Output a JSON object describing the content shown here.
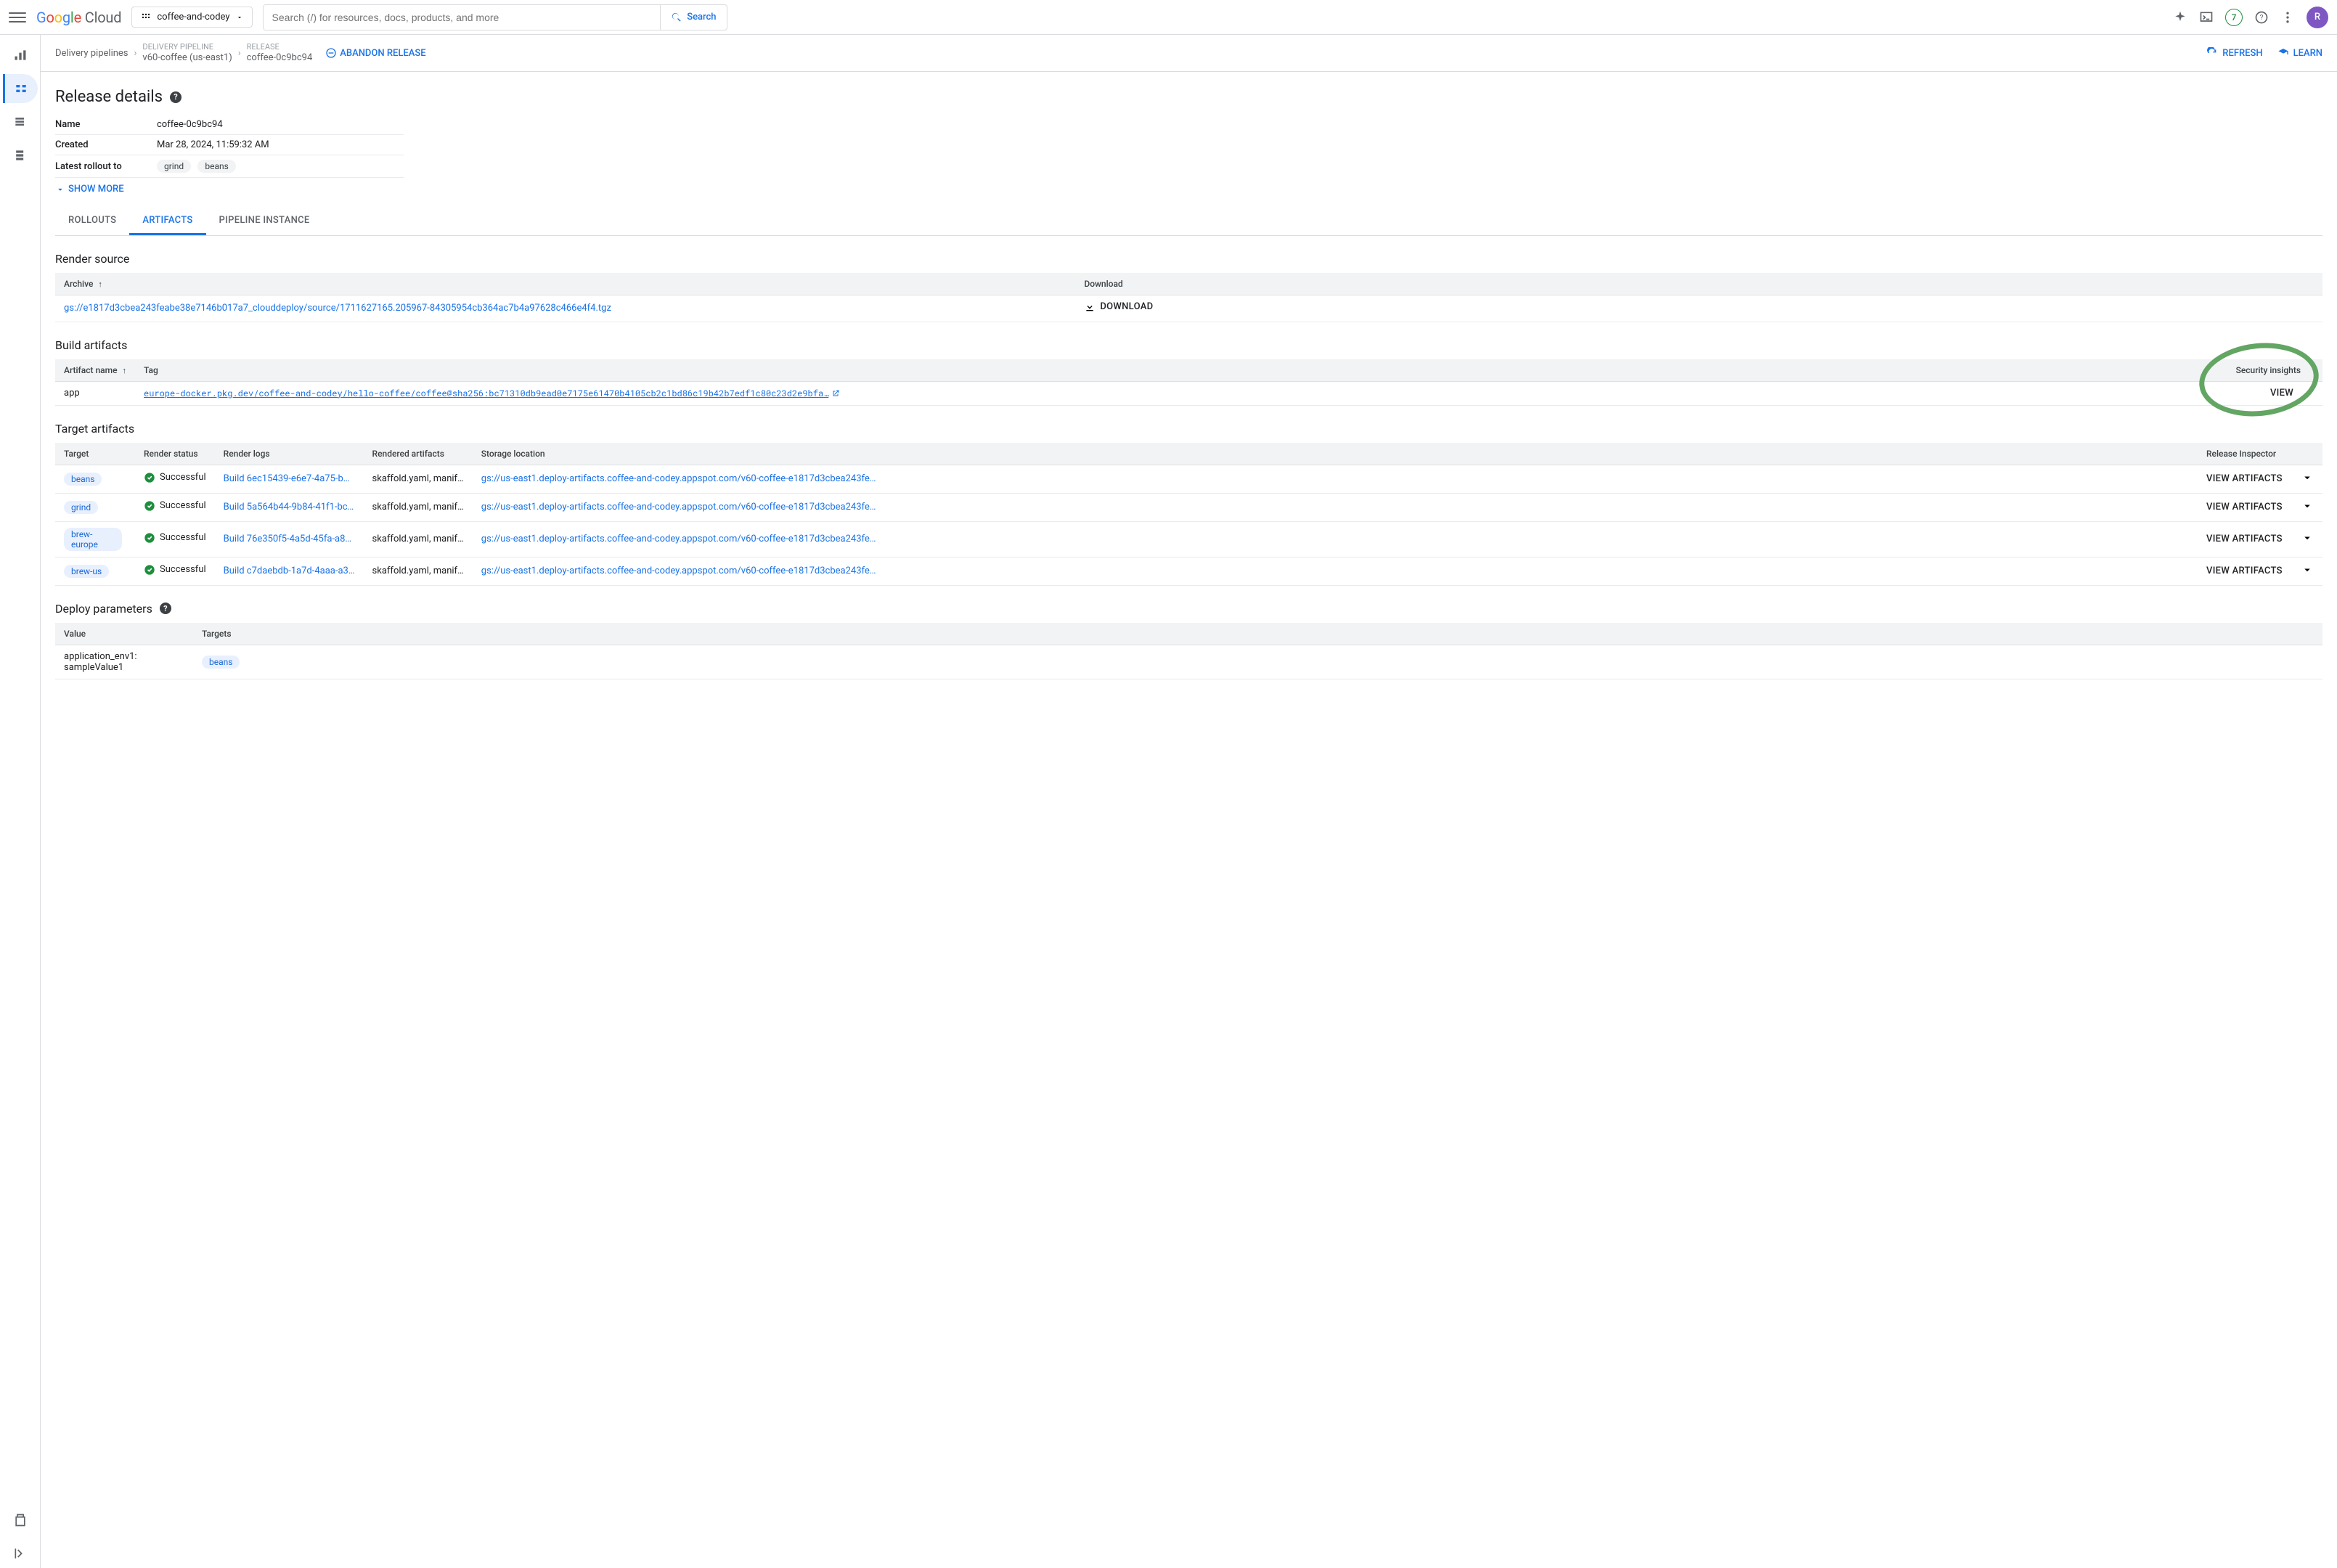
{
  "header": {
    "project": "coffee-and-codey",
    "search_placeholder": "Search (/) for resources, docs, products, and more",
    "search_button": "Search",
    "badge_count": "7",
    "avatar_initial": "R"
  },
  "breadcrumb": {
    "root": "Delivery pipelines",
    "pipeline_label": "DELIVERY PIPELINE",
    "pipeline_value": "v60-coffee (us-east1)",
    "release_label": "RELEASE",
    "release_value": "coffee-0c9bc94",
    "abandon": "ABANDON RELEASE",
    "refresh": "REFRESH",
    "learn": "LEARN"
  },
  "page": {
    "title": "Release details",
    "kv": {
      "name_label": "Name",
      "name_value": "coffee-0c9bc94",
      "created_label": "Created",
      "created_value": "Mar 28, 2024, 11:59:32 AM",
      "rollout_label": "Latest rollout to",
      "rollout_chip1": "grind",
      "rollout_chip2": "beans"
    },
    "show_more": "SHOW MORE"
  },
  "tabs": {
    "rollouts": "ROLLOUTS",
    "artifacts": "ARTIFACTS",
    "pipeline": "PIPELINE INSTANCE"
  },
  "render_source": {
    "title": "Render source",
    "col_archive": "Archive",
    "col_download": "Download",
    "archive_link": "gs://e1817d3cbea243feabe38e7146b017a7_clouddeploy/source/1711627165.205967-84305954cb364ac7b4a97628c466e4f4.tgz",
    "download_label": "DOWNLOAD"
  },
  "build_artifacts": {
    "title": "Build artifacts",
    "col_name": "Artifact name",
    "col_tag": "Tag",
    "col_sec": "Security insights",
    "row_name": "app",
    "row_tag": "europe-docker.pkg.dev/coffee-and-codey/hello-coffee/coffee@sha256:bc71310db9ead0e7175e61470b4105cb2c1bd86c19b42b7edf1c80c23d2e9bfa…",
    "row_view": "VIEW"
  },
  "target_artifacts": {
    "title": "Target artifacts",
    "col_target": "Target",
    "col_status": "Render status",
    "col_logs": "Render logs",
    "col_rendered": "Rendered artifacts",
    "col_storage": "Storage location",
    "col_inspector": "Release Inspector",
    "status_success": "Successful",
    "view_artifacts": "VIEW ARTIFACTS",
    "rows": [
      {
        "target": "beans",
        "logs": "Build 6ec15439-e6e7-4a75-b…",
        "rendered": "skaffold.yaml, manif…",
        "storage": "gs://us-east1.deploy-artifacts.coffee-and-codey.appspot.com/v60-coffee-e1817d3cbea243fe…"
      },
      {
        "target": "grind",
        "logs": "Build 5a564b44-9b84-41f1-bc…",
        "rendered": "skaffold.yaml, manif…",
        "storage": "gs://us-east1.deploy-artifacts.coffee-and-codey.appspot.com/v60-coffee-e1817d3cbea243fe…"
      },
      {
        "target": "brew-europe",
        "logs": "Build 76e350f5-4a5d-45fa-a8…",
        "rendered": "skaffold.yaml, manif…",
        "storage": "gs://us-east1.deploy-artifacts.coffee-and-codey.appspot.com/v60-coffee-e1817d3cbea243fe…"
      },
      {
        "target": "brew-us",
        "logs": "Build c7daebdb-1a7d-4aaa-a3…",
        "rendered": "skaffold.yaml, manif…",
        "storage": "gs://us-east1.deploy-artifacts.coffee-and-codey.appspot.com/v60-coffee-e1817d3cbea243fe…"
      }
    ]
  },
  "deploy_params": {
    "title": "Deploy parameters",
    "col_value": "Value",
    "col_targets": "Targets",
    "row_value": "application_env1: sampleValue1",
    "row_target_chip": "beans"
  }
}
